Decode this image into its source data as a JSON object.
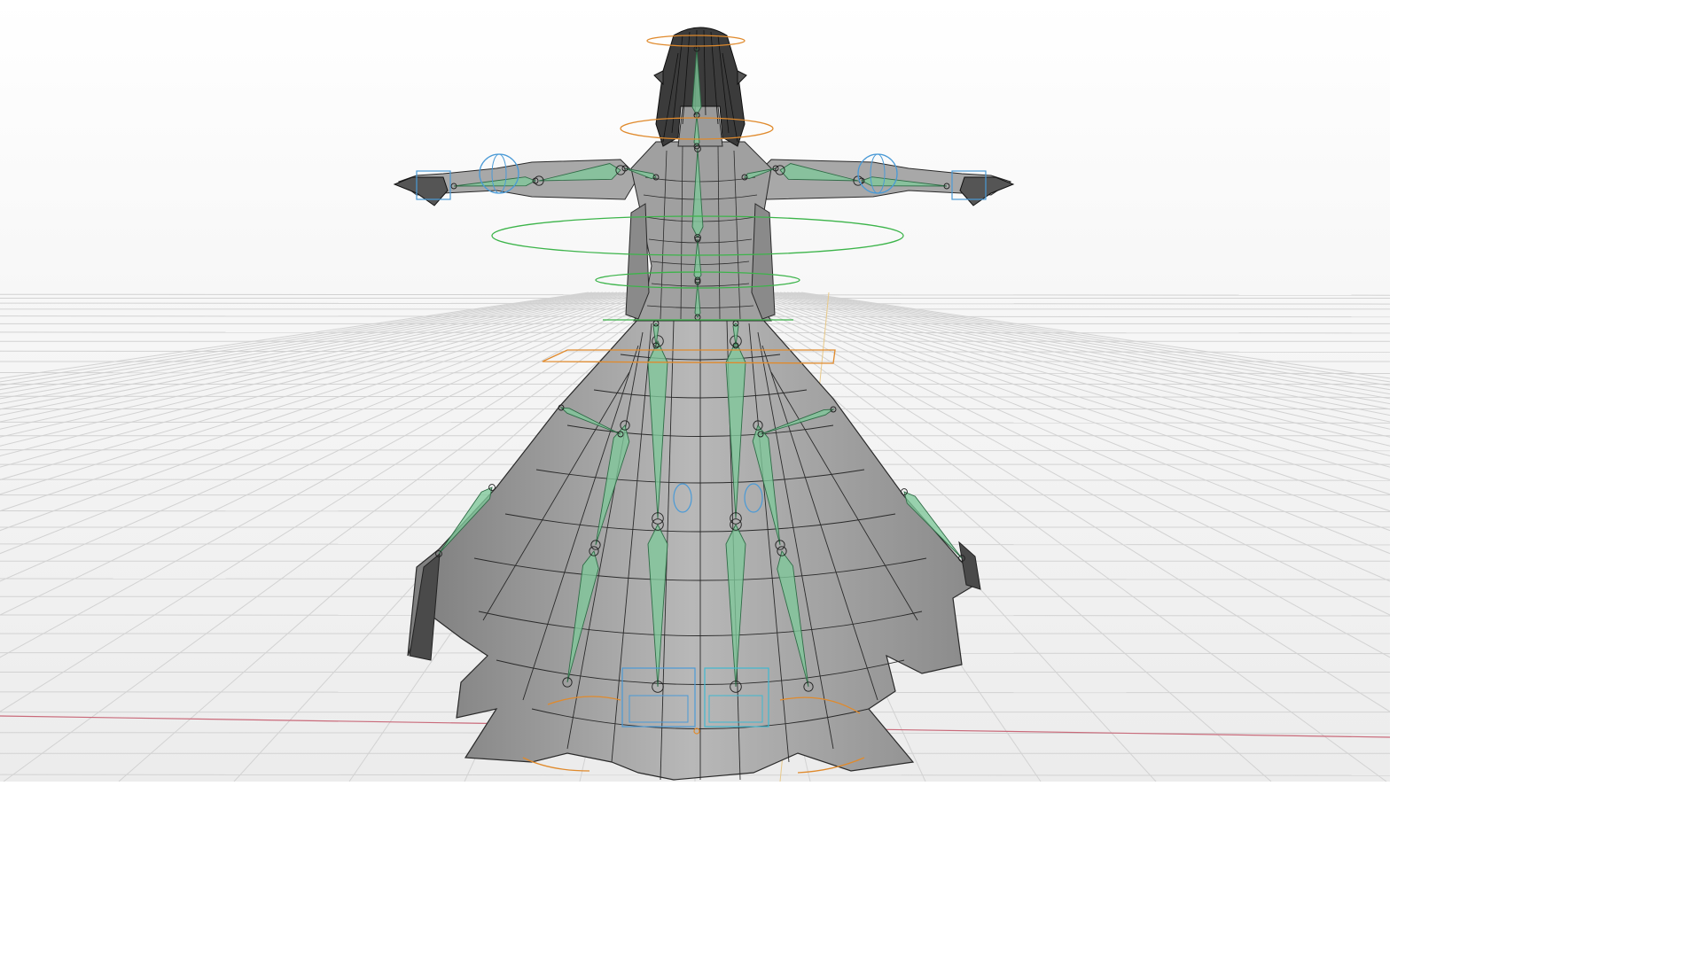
{
  "viewport": {
    "background_top": "#ffffff",
    "background_bottom": "#efefef",
    "grid_color": "#d4d4d4",
    "x_axis_color": "#c96a7a",
    "y_axis_color": "#e8c98a"
  },
  "model": {
    "mesh_fill": "#8f8f8f",
    "mesh_fill_light": "#b4b4b4",
    "mesh_wire": "#2a2a2a",
    "hair_fill": "#3b3b3b"
  },
  "rig": {
    "bone_fill": "#7fc89a",
    "bone_stroke": "#2f6b46",
    "ik_control_color": "#4a9ad6",
    "torso_control_color": "#3cb44a",
    "root_control_color": "#e08a2c"
  },
  "icons": [
    "viewport-grid-icon",
    "mesh-icon",
    "armature-icon"
  ]
}
